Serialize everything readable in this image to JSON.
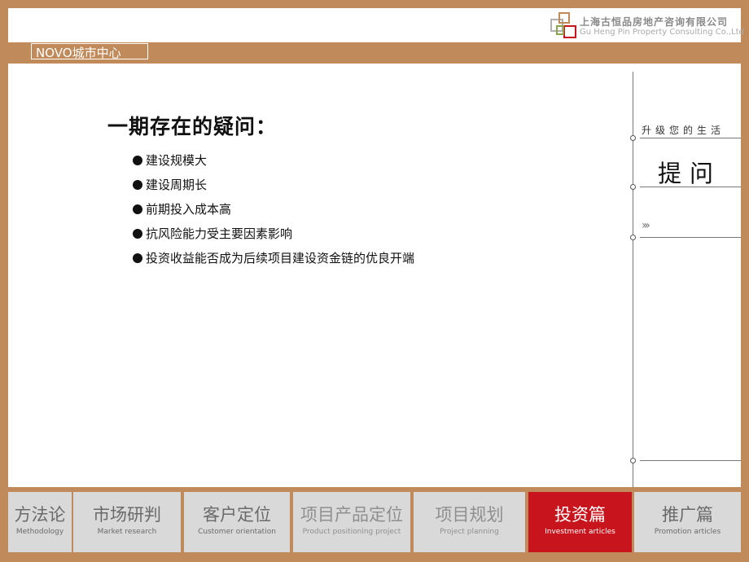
{
  "header": {
    "company_cn": "上海古恒品房地产咨询有限公司",
    "company_en": "Gu Heng Pin Property Consulting Co.,Ltd",
    "project": "NOVO城市中心"
  },
  "main": {
    "title": "一期存在的疑问：",
    "bullets": [
      "建设规模大",
      "建设周期长",
      "前期投入成本高",
      "抗风险能力受主要因素影响",
      "投资收益能否成为后续项目建设资金链的优良开端"
    ]
  },
  "side": {
    "tagline": "升级您的生活",
    "section": "提问",
    "chevrons": "›››"
  },
  "tabs": [
    {
      "cn": "方法论",
      "en": "Methodology"
    },
    {
      "cn": "市场研判",
      "en": "Market research"
    },
    {
      "cn": "客户定位",
      "en": "Customer orientation"
    },
    {
      "cn": "项目产品定位",
      "en": "Product positioning project"
    },
    {
      "cn": "项目规划",
      "en": "Project planning"
    },
    {
      "cn": "投资篇",
      "en": "Investment articles"
    },
    {
      "cn": "推广篇",
      "en": "Promotion articles"
    }
  ],
  "colors": {
    "frame": "#c08a5a",
    "active_tab": "#c8141c",
    "tab": "#d9d9d9"
  }
}
